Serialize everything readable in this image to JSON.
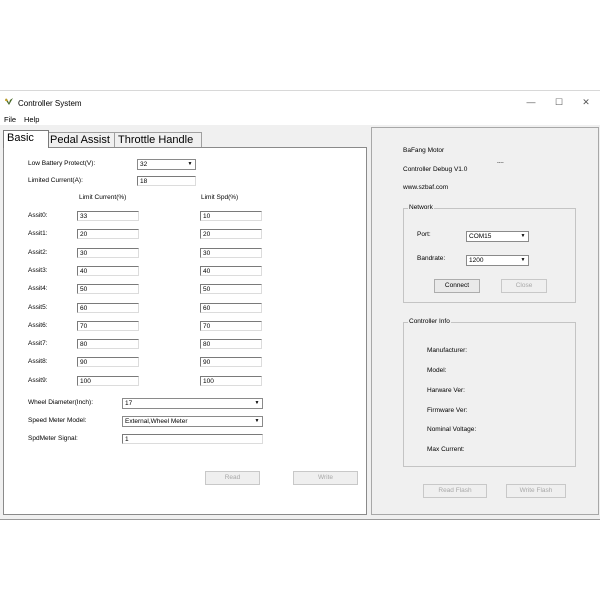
{
  "window": {
    "title": "Controller System",
    "controls": {
      "minimize": "—",
      "maximize": "☐",
      "close": "✕"
    }
  },
  "menu": {
    "file": "File",
    "help": "Help"
  },
  "tabs": [
    {
      "label": "Basic",
      "active": true
    },
    {
      "label": "Pedal Assist",
      "active": false
    },
    {
      "label": "Throttle Handle",
      "active": false
    }
  ],
  "basic": {
    "low_battery_label": "Low Battery Protect(V):",
    "low_battery_value": "32",
    "limited_current_label": "Limited Current(A):",
    "limited_current_value": "18",
    "col_current_header": "Limit Current(%)",
    "col_spd_header": "Limit Spd(%)",
    "assists": [
      {
        "label": "Assit0:",
        "current": "33",
        "spd": "10"
      },
      {
        "label": "Assit1:",
        "current": "20",
        "spd": "20"
      },
      {
        "label": "Assit2:",
        "current": "30",
        "spd": "30"
      },
      {
        "label": "Assit3:",
        "current": "40",
        "spd": "40"
      },
      {
        "label": "Assit4:",
        "current": "50",
        "spd": "50"
      },
      {
        "label": "Assit5:",
        "current": "60",
        "spd": "60"
      },
      {
        "label": "Assit6:",
        "current": "70",
        "spd": "70"
      },
      {
        "label": "Assit7:",
        "current": "80",
        "spd": "80"
      },
      {
        "label": "Assit8:",
        "current": "90",
        "spd": "90"
      },
      {
        "label": "Assit9:",
        "current": "100",
        "spd": "100"
      }
    ],
    "wheel_diameter_label": "Wheel Diameter(Inch):",
    "wheel_diameter_value": "17",
    "speed_meter_label": "Speed Meter Model:",
    "speed_meter_value": "External,Wheel Meter",
    "spdmeter_signal_label": "SpdMeter Signal:",
    "spdmeter_signal_value": "1",
    "read_button": "Read",
    "write_button": "Write"
  },
  "info": {
    "company": "BaFang Motor",
    "product": "Controller Debug V1.0",
    "version_mark": "----",
    "website": "www.szbaf.com"
  },
  "network": {
    "title": "Network",
    "port_label": "Port:",
    "port_value": "COM15",
    "baudrate_label": "Bandrate:",
    "baudrate_value": "1200",
    "connect_button": "Connect",
    "close_button": "Close"
  },
  "controller_info": {
    "title": "Controller Info",
    "fields": [
      "Manufacturer:",
      "Model:",
      "Harware Ver:",
      "Firmware Ver:",
      "Nominal Voltage:",
      "Max Current:"
    ]
  },
  "flash": {
    "read_button": "Read Flash",
    "write_button": "Write Flash"
  }
}
